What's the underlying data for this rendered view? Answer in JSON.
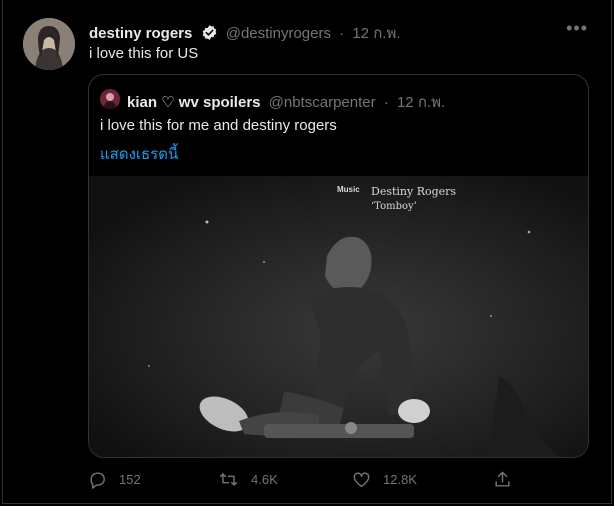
{
  "tweet": {
    "author_name": "destiny rogers",
    "author_handle": "@destinyrogers",
    "separator": "·",
    "date": "12 ก.พ.",
    "text": "i love this for US",
    "more_icon": "more-horizontal-icon",
    "avatar_icon": "avatar-image"
  },
  "quoted": {
    "author_name": "kian ♡ wv spoilers",
    "author_handle": "@nbtscarpenter",
    "separator": "·",
    "date": "12 ก.พ.",
    "text": "i love this for me and destiny rogers",
    "show_thread": "แสดงเธรดนี้",
    "media": {
      "label_small": "Music",
      "label_artist": "Destiny Rogers",
      "label_title": "‘Tomboy’"
    }
  },
  "actions": {
    "reply_count": "152",
    "retweet_count": "4.6K",
    "like_count": "12.8K"
  },
  "colors": {
    "background": "#000000",
    "text": "#e7e9ea",
    "muted": "#71767b",
    "link": "#1d9bf0",
    "border": "#2f3336"
  }
}
